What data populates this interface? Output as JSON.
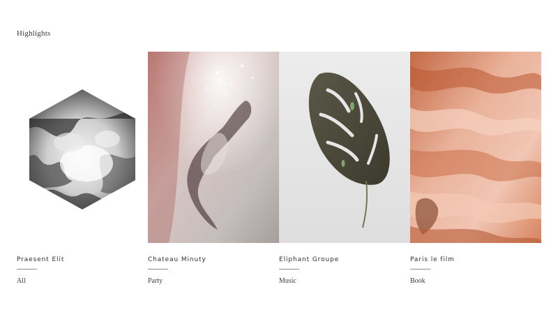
{
  "section": {
    "title": "Highlights"
  },
  "cards": [
    {
      "title": "Praesent Elit",
      "category": "All",
      "image": "hexagon-clouds-image"
    },
    {
      "title": "Chateau Minuty",
      "category": "Party",
      "image": "underwater-figure-image"
    },
    {
      "title": "Eliphant Groupe",
      "category": "Music",
      "image": "monstera-leaf-image"
    },
    {
      "title": "Paris le film",
      "category": "Book",
      "image": "sandstone-canyon-image"
    }
  ],
  "colors": {
    "background": "#ffffff",
    "text": "#2e2e2e",
    "rule": "#8c8c8c"
  }
}
